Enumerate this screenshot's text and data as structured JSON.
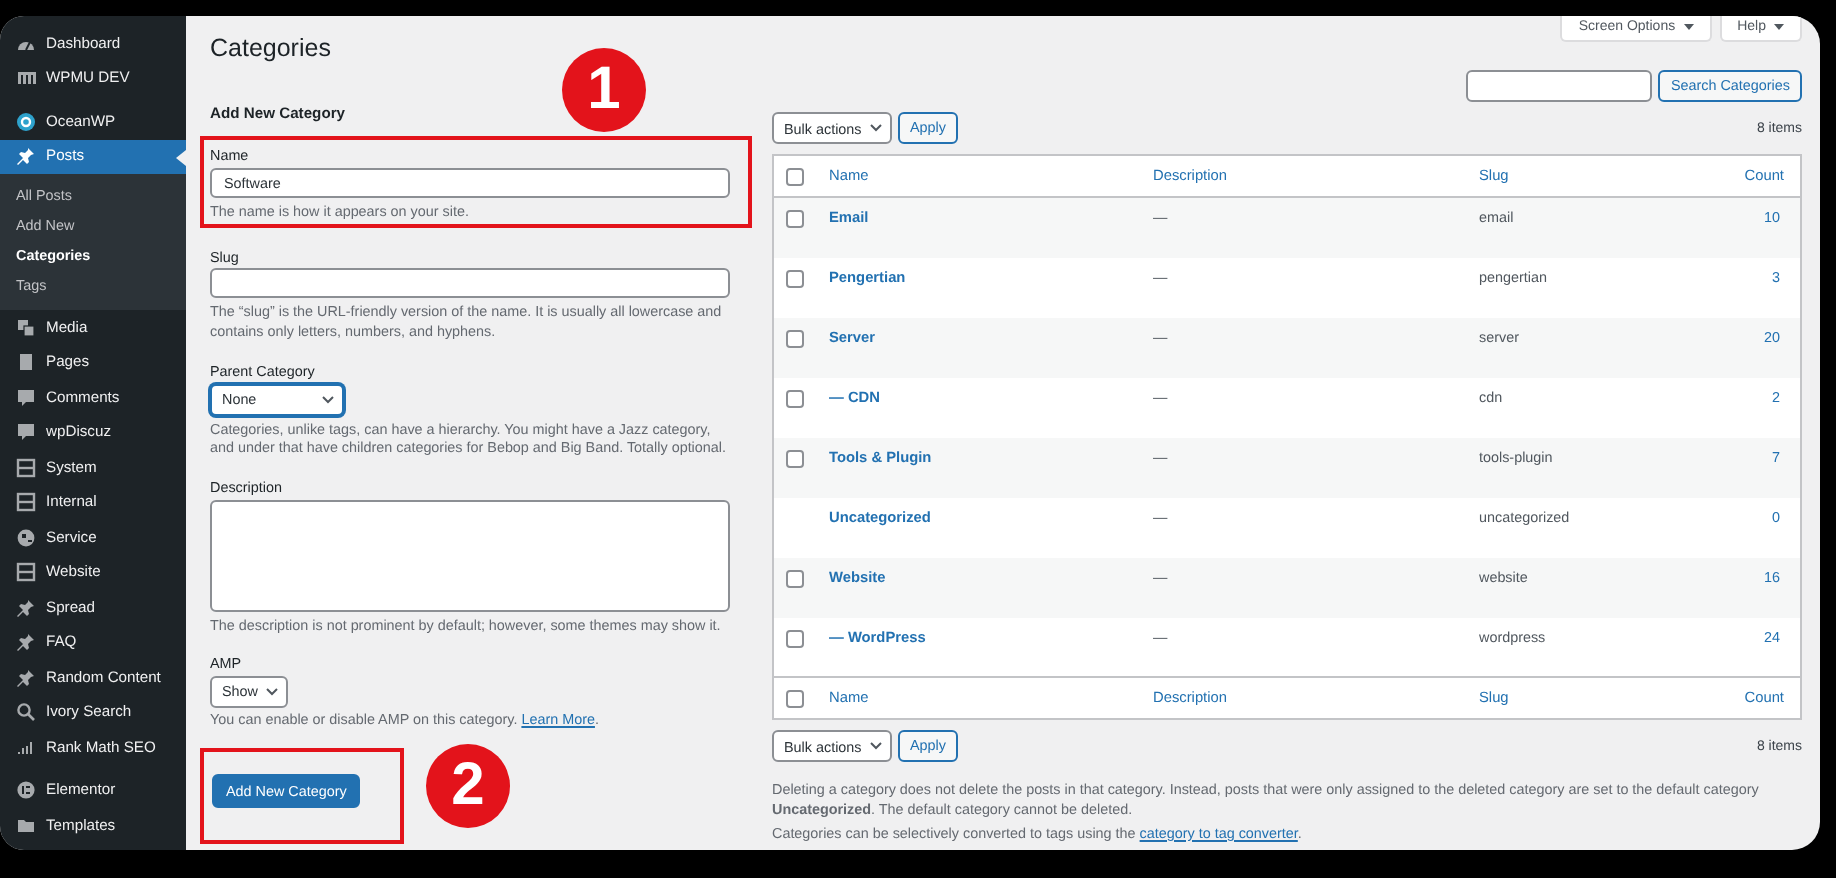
{
  "sidebar": {
    "groups": [
      {
        "items": [
          {
            "label": "Dashboard",
            "selected": false
          },
          {
            "label": "WPMU DEV",
            "selected": false
          }
        ]
      },
      {
        "items": [
          {
            "label": "OceanWP",
            "selected": false
          },
          {
            "label": "Posts",
            "selected": true,
            "expanded": true,
            "children": [
              {
                "label": "All Posts",
                "selected": false
              },
              {
                "label": "Add New",
                "selected": false
              },
              {
                "label": "Categories",
                "selected": true
              },
              {
                "label": "Tags",
                "selected": false
              }
            ]
          },
          {
            "label": "Media",
            "selected": false
          },
          {
            "label": "Pages",
            "selected": false
          },
          {
            "label": "Comments",
            "selected": false
          },
          {
            "label": "wpDiscuz",
            "selected": false
          },
          {
            "label": "System",
            "selected": false
          },
          {
            "label": "Internal",
            "selected": false
          },
          {
            "label": "Service",
            "selected": false
          },
          {
            "label": "Website",
            "selected": false
          },
          {
            "label": "Spread",
            "selected": false
          },
          {
            "label": "FAQ",
            "selected": false
          },
          {
            "label": "Random Content",
            "selected": false
          },
          {
            "label": "Ivory Search",
            "selected": false
          },
          {
            "label": "Rank Math SEO",
            "selected": false
          }
        ]
      },
      {
        "items": [
          {
            "label": "Elementor",
            "selected": false
          },
          {
            "label": "Templates",
            "selected": false
          }
        ]
      }
    ]
  },
  "screen_meta": [
    "Screen Options",
    "Help"
  ],
  "page_title": "Categories",
  "form": {
    "heading": "Add New Category",
    "name": {
      "label": "Name",
      "value": "Software",
      "help": "The name is how it appears on your site."
    },
    "slug": {
      "label": "Slug",
      "help": "The “slug” is the URL-friendly version of the name. It is usually all lowercase and contains only letters, numbers, and hyphens."
    },
    "parent": {
      "label": "Parent Category",
      "value": "None",
      "help": "Categories, unlike tags, can have a hierarchy. You might have a Jazz category, and under that have children categories for Bebop and Big Band. Totally optional."
    },
    "description": {
      "label": "Description",
      "help": "The description is not prominent by default; however, some themes may show it."
    },
    "amp": {
      "label": "AMP",
      "value": "Show",
      "help": "You can enable or disable AMP on this category.",
      "link": "Learn More",
      "after": "."
    },
    "submit": "Add New Category"
  },
  "annotations": [
    {
      "label": "1"
    },
    {
      "label": "2"
    }
  ],
  "search": {
    "button": "Search Categories"
  },
  "tablenav_top": {
    "bulk": "Bulk actions",
    "apply": "Apply",
    "count": "8 items"
  },
  "table": {
    "head_checked": false,
    "columns": [
      "Name",
      "Description",
      "Slug",
      "Count"
    ],
    "rows": [
      {
        "name": "Email",
        "description": "—",
        "slug": "email",
        "count": "10",
        "checked": false
      },
      {
        "name": "Pengertian",
        "description": "—",
        "slug": "pengertian",
        "count": "3",
        "checked": false
      },
      {
        "name": "Server",
        "description": "—",
        "slug": "server",
        "count": "20",
        "checked": false
      },
      {
        "name": "— CDN",
        "description": "—",
        "slug": "cdn",
        "count": "2",
        "checked": false
      },
      {
        "name": "Tools & Plugin",
        "description": "—",
        "slug": "tools-plugin",
        "count": "7",
        "checked": false
      },
      {
        "name": "Uncategorized",
        "description": "—",
        "slug": "uncategorized",
        "count": "0"
      },
      {
        "name": "Website",
        "description": "—",
        "slug": "website",
        "count": "16",
        "checked": false
      },
      {
        "name": "— WordPress",
        "description": "—",
        "slug": "wordpress",
        "count": "24",
        "checked": false
      }
    ],
    "foot_checked": false,
    "footer_columns": [
      "Name",
      "Description",
      "Slug",
      "Count"
    ]
  },
  "tablenav_bottom": {
    "bulk": "Bulk actions",
    "apply": "Apply",
    "count": "8 items"
  },
  "notes": [
    {
      "text": "Deleting a category does not delete the posts in that category. Instead, posts that were only assigned to the deleted category are set to the default category **Uncategorized**. The default category cannot be deleted."
    },
    {
      "text": "Categories can be selectively converted to tags using the ",
      "link": "category to tag converter",
      "after": "."
    }
  ]
}
